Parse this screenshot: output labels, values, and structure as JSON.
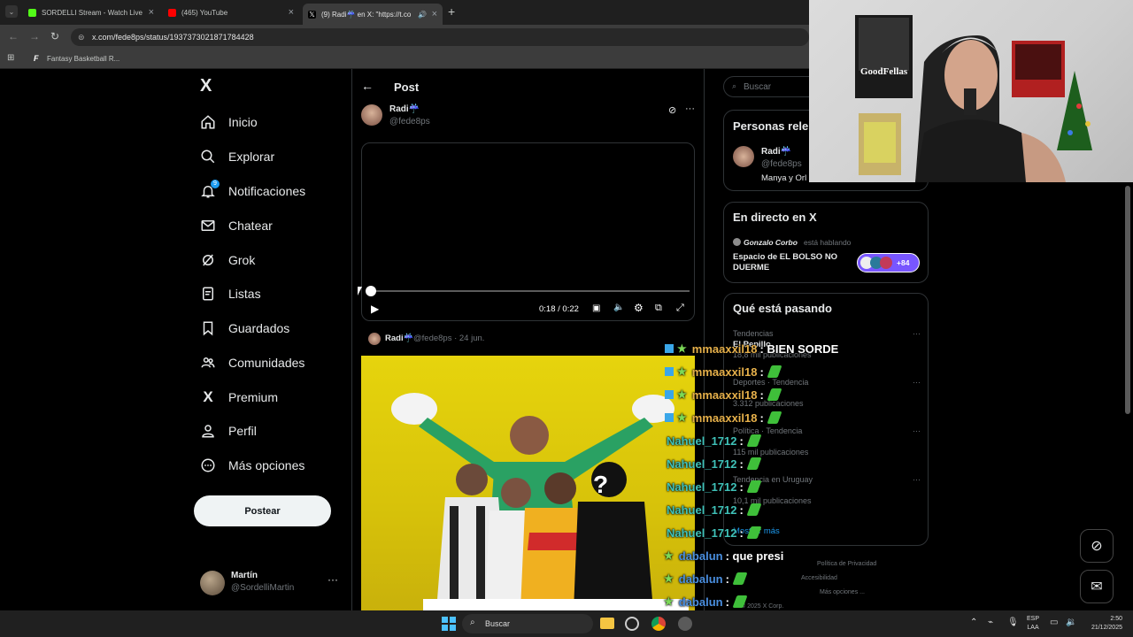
{
  "browser": {
    "tabs": [
      {
        "title": "SORDELLI Stream - Watch Live",
        "favicon_color": "#53fc18"
      },
      {
        "title": "(465) YouTube",
        "favicon_color": "#ff0000"
      },
      {
        "title": "(9) Radi☔ en X: \"https://t.co",
        "favicon_color": "#ffffff"
      }
    ],
    "new_tab": "+",
    "url": "x.com/fede8ps/status/1937373021871784428",
    "bookmark": "Fantasy Basketball R..."
  },
  "nav": {
    "logo": "X",
    "items": [
      {
        "label": "Inicio",
        "icon": "home-icon"
      },
      {
        "label": "Explorar",
        "icon": "search-icon"
      },
      {
        "label": "Notificaciones",
        "icon": "bell-icon",
        "badge": "9"
      },
      {
        "label": "Chatear",
        "icon": "mail-icon"
      },
      {
        "label": "Grok",
        "icon": "grok-icon"
      },
      {
        "label": "Listas",
        "icon": "list-icon"
      },
      {
        "label": "Guardados",
        "icon": "bookmark-icon"
      },
      {
        "label": "Comunidades",
        "icon": "people-icon"
      },
      {
        "label": "Premium",
        "icon": "x-icon"
      },
      {
        "label": "Perfil",
        "icon": "person-icon"
      },
      {
        "label": "Más opciones",
        "icon": "more-circle-icon"
      }
    ],
    "post_button": "Postear",
    "account": {
      "name": "Martín",
      "handle": "@SordelliMartin",
      "more": "···"
    }
  },
  "post": {
    "header": "Post",
    "author_name": "Radi☔",
    "author_handle": "@fede8ps",
    "more": "···",
    "video_time": "0:18 / 0:22",
    "video_progress": 0.0,
    "quoted": {
      "author": "Radi☔",
      "meta": "@fede8ps · 24 jun."
    }
  },
  "sidebar": {
    "search_placeholder": "Buscar",
    "people_title": "Personas rele",
    "person": {
      "name": "Radi☔",
      "handle": "@fede8ps",
      "bio": "Manya y Orl"
    },
    "live_title": "En directo en X",
    "live_host": "Gonzalo Corbo",
    "live_status": "está hablando",
    "live_space": "Espacio de EL BOLSO NO DUERME",
    "live_count": "+84",
    "trending_title": "Qué está pasando",
    "trends": [
      {
        "context": "Tendencias",
        "topic": "El Pepillo",
        "count": "18,8 mil publicaciones"
      },
      {
        "context": "Deportes · Tendencia",
        "topic": "",
        "count": "3.312 publicaciones"
      },
      {
        "context": "Política · Tendencia",
        "topic": "",
        "count": "115 mil publicaciones"
      },
      {
        "context": "Tendencia en Uruguay",
        "topic": "",
        "count": "10,1 mil publicaciones"
      }
    ],
    "show_more": "Mostrar más",
    "footer": [
      "Política de Privacidad",
      "Accesibilidad",
      "Más opciones ...",
      "© 2025 X Corp."
    ]
  },
  "chat": [
    {
      "user": "mmaaxxil18",
      "message": ": BIEN SORDE",
      "color": "#e6b04a",
      "emote": false,
      "badge": true
    },
    {
      "user": "mmaaxxil18",
      "message": ":",
      "color": "#e6b04a",
      "emote": true,
      "badge": true
    },
    {
      "user": "mmaaxxil18",
      "message": ":",
      "color": "#e6b04a",
      "emote": true,
      "badge": true
    },
    {
      "user": "mmaaxxil18",
      "message": ":",
      "color": "#e6b04a",
      "emote": true,
      "badge": true
    },
    {
      "user": "Nahuel_1712",
      "message": ":",
      "color": "#3fc1b8",
      "emote": true,
      "badge": false
    },
    {
      "user": "Nahuel_1712",
      "message": ":",
      "color": "#3fc1b8",
      "emote": true,
      "badge": false
    },
    {
      "user": "Nahuel_1712",
      "message": ":",
      "color": "#3fc1b8",
      "emote": true,
      "badge": false
    },
    {
      "user": "Nahuel_1712",
      "message": ":",
      "color": "#3fc1b8",
      "emote": true,
      "badge": false
    },
    {
      "user": "Nahuel_1712",
      "message": ":",
      "color": "#3fc1b8",
      "emote": true,
      "badge": false
    },
    {
      "user": "dabalun",
      "message": ": que presi",
      "color": "#4a8fe0",
      "emote": false,
      "badge": false,
      "star": true
    },
    {
      "user": "dabalun",
      "message": ":",
      "color": "#4a8fe0",
      "emote": true,
      "badge": false,
      "star": true
    },
    {
      "user": "dabalun",
      "message": ":",
      "color": "#4a8fe0",
      "emote": true,
      "badge": false,
      "star": true
    },
    {
      "user": "dabalun",
      "message": ":",
      "color": "#4a8fe0",
      "emote": true,
      "badge": false,
      "star": true
    }
  ],
  "taskbar": {
    "search": "Buscar",
    "lang": "ESP",
    "lang2": "LAA",
    "time": "2:50",
    "date": "21/12/2025"
  },
  "colors": {
    "accent": "#1d9bf0",
    "background": "#000000",
    "border": "#2f3336"
  }
}
